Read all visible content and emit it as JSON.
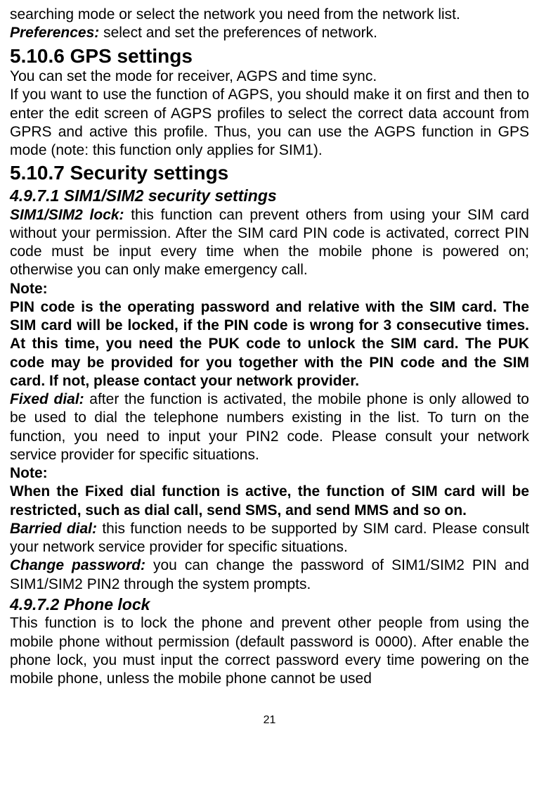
{
  "p1": "searching mode or select the network you need from the network list.",
  "preferences_label": "Preferences:",
  "preferences_text": " select and set the preferences of network.",
  "h_gps": "5.10.6 GPS settings",
  "gps_p1": "You can set the mode for receiver, AGPS and time sync.",
  "gps_p2": "If you want to use the function of AGPS, you should make it on first and then to enter the edit screen of AGPS profiles to select the correct data account from GPRS and active this profile. Thus, you can use the AGPS function in GPS mode (note: this function only applies for SIM1).",
  "h_security": "5.10.7 Security settings",
  "h_sim_security": "4.9.7.1 SIM1/SIM2 security settings",
  "sim_lock_label": "SIM1/SIM2 lock:",
  "sim_lock_text": " this function can prevent others from using your SIM card without your permission. After the SIM card PIN code is activated, correct PIN code must be input every time when the mobile phone is powered on; otherwise you can only make emergency call.",
  "note1_head": "Note:",
  "note1_body": "PIN code is the operating password and relative with the SIM card. The SIM card will be locked, if the PIN code is wrong for 3 consecutive times. At this time, you need the PUK code to unlock the SIM card. The PUK code may be provided for you together with the PIN code and the SIM card. If not, please contact your network provider.",
  "fixed_dial_label": "Fixed dial:",
  "fixed_dial_text": " after the function is activated, the mobile phone is only allowed to be used to dial the telephone numbers existing in the list. To turn on the function, you need to input your PIN2 code. Please consult your network service provider for specific situations.",
  "note2_head": "Note:",
  "note2_body": "When the Fixed dial function is active, the function of SIM card will be restricted, such as dial call, send SMS, and send MMS and so on.",
  "barried_label": "Barried dial:",
  "barried_text": " this function needs to be supported by SIM card. Please consult your network service provider for specific situations.",
  "change_pw_label": "Change password:",
  "change_pw_text": " you can change the password of SIM1/SIM2 PIN and SIM1/SIM2 PIN2 through the system prompts.",
  "h_phone_lock": "4.9.7.2 Phone lock",
  "phone_lock_text": "This function is to lock the phone and prevent other people from using the mobile phone without permission (default password is 0000). After enable the phone lock, you must input the correct password every time powering on the mobile phone, unless the mobile phone cannot be used",
  "page_number": "21"
}
